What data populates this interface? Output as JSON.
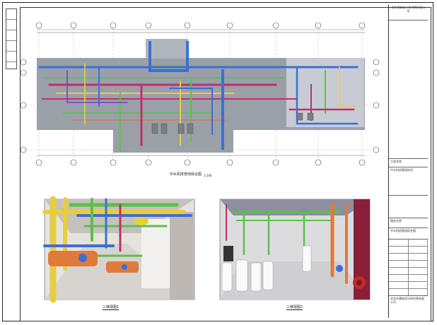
{
  "drawing": {
    "plan_caption": "中水机房管线综合图",
    "plan_scale": "1:100",
    "view1_caption": "三维视图1",
    "view2_caption": "三维视图2"
  },
  "title_block": {
    "company_top": "北京建筑设计研究院有限公司",
    "project_label": "工程名称",
    "project_name": "中水机房管线综合",
    "drawing_label": "图纸名称",
    "drawing_name": "中水机房管线综合图",
    "footer": "北京市建筑设计研究院有限公司"
  },
  "colors": {
    "duct_blue": "#3b6fd6",
    "pipe_green": "#5cc04a",
    "pipe_yellow": "#e8cf3a",
    "pipe_magenta": "#c0306a",
    "pipe_orange": "#e07a3a",
    "slab_gray": "#9aa0a8"
  }
}
